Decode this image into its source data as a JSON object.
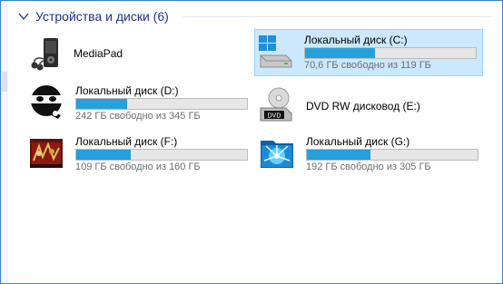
{
  "group": {
    "title": "Устройства и диски (6)"
  },
  "devices": [
    {
      "name": "MediaPad"
    },
    {
      "name": "Локальный диск (C:)",
      "free": "70,6 ГБ свободно из 119 ГБ",
      "used_fraction": 0.41,
      "selected": true
    },
    {
      "name": "Локальный диск (D:)",
      "free": "242 ГБ свободно из 345 ГБ",
      "used_fraction": 0.3
    },
    {
      "name": "DVD RW дисковод (E:)",
      "icon_label": "DVD"
    },
    {
      "name": "Локальный диск (F:)",
      "free": "109 ГБ свободно из 160 ГБ",
      "used_fraction": 0.32
    },
    {
      "name": "Локальный диск (G:)",
      "free": "192 ГБ свободно из 305 ГБ",
      "used_fraction": 0.37
    }
  ],
  "colors": {
    "accent": "#26a0da",
    "selection": "#cce8ff",
    "header": "#1e3287"
  },
  "icons": [
    "chevron-down-icon",
    "media-player-icon",
    "windows-drive-icon",
    "ninja-drive-icon",
    "dvd-drive-icon",
    "red-art-drive-icon",
    "blue-swirl-drive-icon"
  ]
}
